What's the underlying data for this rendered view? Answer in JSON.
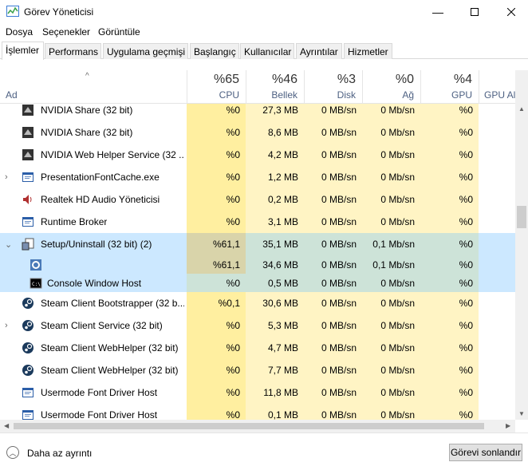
{
  "window": {
    "title": "Görev Yöneticisi"
  },
  "menu": [
    "Dosya",
    "Seçenekler",
    "Görüntüle"
  ],
  "tabs": [
    "İşlemler",
    "Performans",
    "Uygulama geçmişi",
    "Başlangıç",
    "Kullanıcılar",
    "Ayrıntılar",
    "Hizmetler"
  ],
  "active_tab": "İşlemler",
  "columns": {
    "name": "Ad",
    "cpu": {
      "pct": "%65",
      "label": "CPU"
    },
    "mem": {
      "pct": "%46",
      "label": "Bellek"
    },
    "disk": {
      "pct": "%3",
      "label": "Disk"
    },
    "net": {
      "pct": "%0",
      "label": "Ağ"
    },
    "gpu": {
      "pct": "%4",
      "label": "GPU"
    },
    "gpu_engine": {
      "label": "GPU Altyap"
    }
  },
  "rows": [
    {
      "name": "NVIDIA Share (32 bit)",
      "icon": "nvidia-icon",
      "cpu": "%0",
      "mem": "27,3 MB",
      "disk": "0 MB/sn",
      "net": "0 Mb/sn",
      "gpu": "%0",
      "partial": true
    },
    {
      "name": "NVIDIA Share (32 bit)",
      "icon": "nvidia-icon",
      "cpu": "%0",
      "mem": "8,6 MB",
      "disk": "0 MB/sn",
      "net": "0 Mb/sn",
      "gpu": "%0"
    },
    {
      "name": "NVIDIA Web Helper Service (32 ...",
      "icon": "nvidia-icon",
      "cpu": "%0",
      "mem": "4,2 MB",
      "disk": "0 MB/sn",
      "net": "0 Mb/sn",
      "gpu": "%0"
    },
    {
      "name": "PresentationFontCache.exe",
      "icon": "window-icon",
      "expand": "›",
      "cpu": "%0",
      "mem": "1,2 MB",
      "disk": "0 MB/sn",
      "net": "0 Mb/sn",
      "gpu": "%0"
    },
    {
      "name": "Realtek HD Audio Yöneticisi",
      "icon": "speaker-icon",
      "cpu": "%0",
      "mem": "0,2 MB",
      "disk": "0 MB/sn",
      "net": "0 Mb/sn",
      "gpu": "%0"
    },
    {
      "name": "Runtime Broker",
      "icon": "window-icon",
      "cpu": "%0",
      "mem": "3,1 MB",
      "disk": "0 MB/sn",
      "net": "0 Mb/sn",
      "gpu": "%0"
    },
    {
      "name": "Setup/Uninstall (32 bit) (2)",
      "icon": "setup-icon",
      "expand": "⌄",
      "cpu": "%61,1",
      "mem": "35,1 MB",
      "disk": "0 MB/sn",
      "net": "0,1 Mb/sn",
      "gpu": "%0",
      "selected": true,
      "hot": true
    },
    {
      "name": "",
      "icon": "gear-icon",
      "child": true,
      "cpu": "%61,1",
      "mem": "34,6 MB",
      "disk": "0 MB/sn",
      "net": "0,1 Mb/sn",
      "gpu": "%0",
      "selected": true,
      "hot": true
    },
    {
      "name": "Console Window Host",
      "icon": "console-icon",
      "child": true,
      "cpu": "%0",
      "mem": "0,5 MB",
      "disk": "0 MB/sn",
      "net": "0 Mb/sn",
      "gpu": "%0",
      "selected": true
    },
    {
      "name": "Steam Client Bootstrapper (32 b...",
      "icon": "steam-icon",
      "cpu": "%0,1",
      "mem": "30,6 MB",
      "disk": "0 MB/sn",
      "net": "0 Mb/sn",
      "gpu": "%0"
    },
    {
      "name": "Steam Client Service (32 bit)",
      "icon": "steam-icon",
      "expand": "›",
      "cpu": "%0",
      "mem": "5,3 MB",
      "disk": "0 MB/sn",
      "net": "0 Mb/sn",
      "gpu": "%0"
    },
    {
      "name": "Steam Client WebHelper (32 bit)",
      "icon": "steam-icon",
      "cpu": "%0",
      "mem": "4,7 MB",
      "disk": "0 MB/sn",
      "net": "0 Mb/sn",
      "gpu": "%0"
    },
    {
      "name": "Steam Client WebHelper (32 bit)",
      "icon": "steam-icon",
      "cpu": "%0",
      "mem": "7,7 MB",
      "disk": "0 MB/sn",
      "net": "0 Mb/sn",
      "gpu": "%0"
    },
    {
      "name": "Usermode Font Driver Host",
      "icon": "window-icon",
      "cpu": "%0",
      "mem": "11,8 MB",
      "disk": "0 MB/sn",
      "net": "0 Mb/sn",
      "gpu": "%0"
    },
    {
      "name": "Usermode Font Driver Host",
      "icon": "window-icon",
      "cpu": "%0",
      "mem": "0,1 MB",
      "disk": "0 MB/sn",
      "net": "0 Mb/sn",
      "gpu": "%0"
    }
  ],
  "footer": {
    "fewer_details": "Daha az ayrıntı",
    "end_task": "Görevi sonlandır"
  }
}
